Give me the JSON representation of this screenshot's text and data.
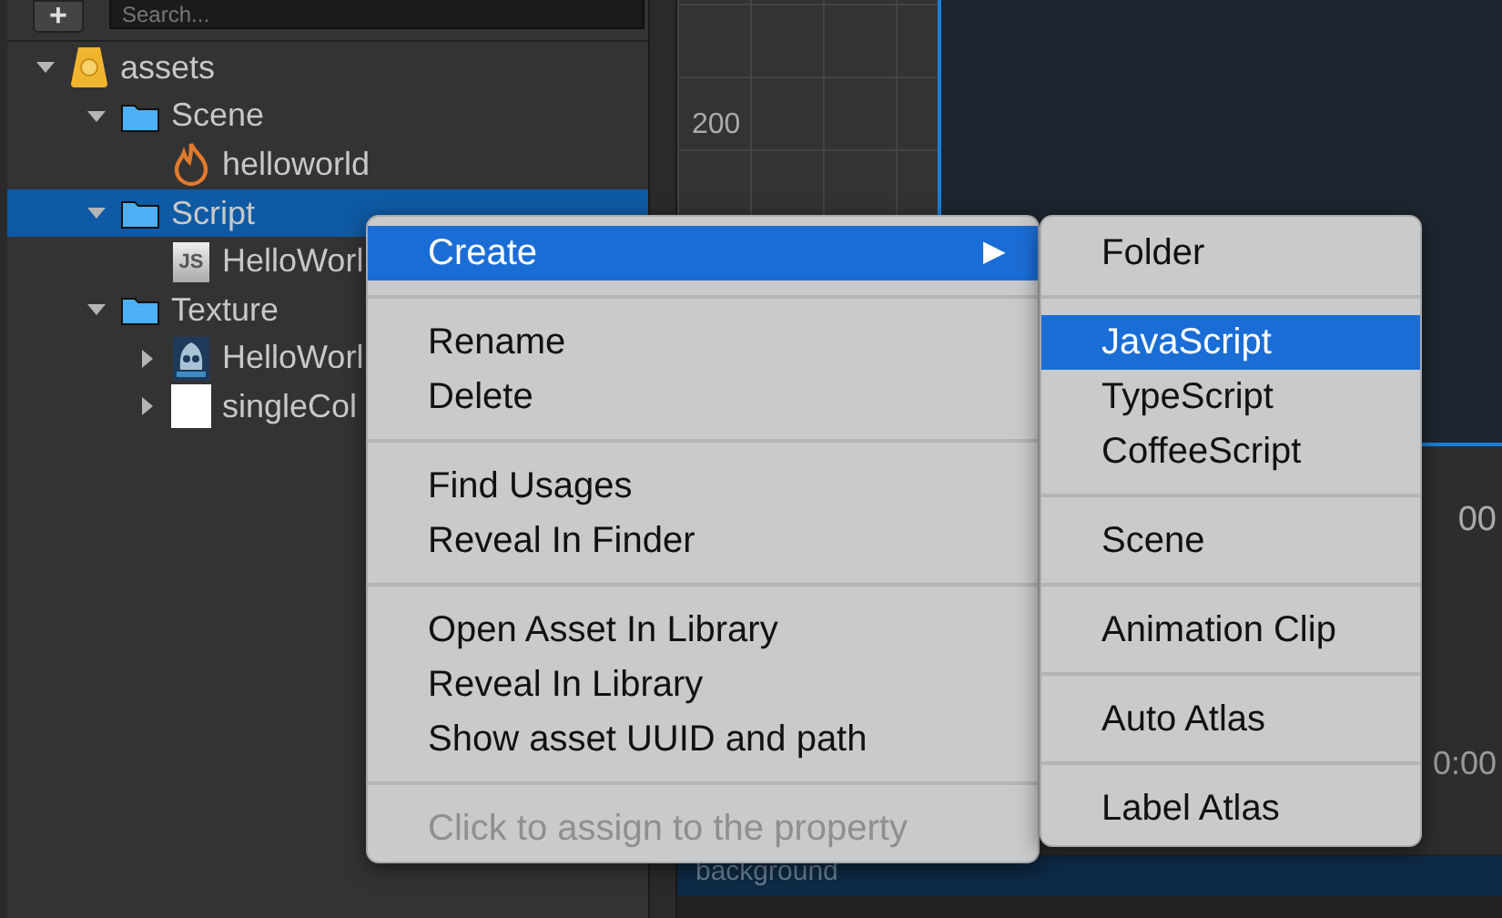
{
  "toolbar": {
    "add_button": "+",
    "search": {
      "placeholder": "Search..."
    }
  },
  "tree": [
    {
      "label": "assets",
      "kind": "database",
      "expanded": true,
      "selected": false,
      "children": [
        {
          "label": "Scene",
          "kind": "folder",
          "expanded": true,
          "selected": false,
          "children": [
            {
              "label": "helloworld",
              "kind": "scene",
              "selected": false
            }
          ]
        },
        {
          "label": "Script",
          "kind": "folder",
          "expanded": true,
          "selected": true,
          "children": [
            {
              "label": "HelloWorl",
              "kind": "script",
              "icon_text": "JS",
              "selected": false
            }
          ]
        },
        {
          "label": "Texture",
          "kind": "folder",
          "expanded": true,
          "selected": false,
          "children": [
            {
              "label": "HelloWorl",
              "kind": "image",
              "expanded": false,
              "selected": false
            },
            {
              "label": "singleCol",
              "kind": "blank",
              "expanded": false,
              "selected": false
            }
          ]
        }
      ]
    }
  ],
  "scene_view": {
    "ruler_label": "200"
  },
  "timeline": {
    "ruler_label": "00",
    "time_label": "0:00"
  },
  "node_label": "background",
  "context_menu": {
    "groups": [
      [
        {
          "label": "Create",
          "highlighted": true,
          "disabled": false,
          "submenu_arrow": "▶"
        }
      ],
      [
        {
          "label": "Rename",
          "highlighted": false,
          "disabled": false
        },
        {
          "label": "Delete",
          "highlighted": false,
          "disabled": false
        }
      ],
      [
        {
          "label": "Find Usages",
          "highlighted": false,
          "disabled": false
        },
        {
          "label": "Reveal In Finder",
          "highlighted": false,
          "disabled": false
        }
      ],
      [
        {
          "label": "Open Asset In Library",
          "highlighted": false,
          "disabled": false
        },
        {
          "label": "Reveal In Library",
          "highlighted": false,
          "disabled": false
        },
        {
          "label": "Show asset UUID and path",
          "highlighted": false,
          "disabled": false
        }
      ],
      [
        {
          "label": "Click to assign to the property",
          "highlighted": false,
          "disabled": true
        }
      ]
    ]
  },
  "submenu": {
    "groups": [
      [
        {
          "label": "Folder",
          "highlighted": false
        }
      ],
      [
        {
          "label": "JavaScript",
          "highlighted": true
        },
        {
          "label": "TypeScript",
          "highlighted": false
        },
        {
          "label": "CoffeeScript",
          "highlighted": false
        }
      ],
      [
        {
          "label": "Scene",
          "highlighted": false
        }
      ],
      [
        {
          "label": "Animation Clip",
          "highlighted": false
        }
      ],
      [
        {
          "label": "Auto Atlas",
          "highlighted": false
        }
      ],
      [
        {
          "label": "Label Atlas",
          "highlighted": false
        }
      ]
    ]
  }
}
